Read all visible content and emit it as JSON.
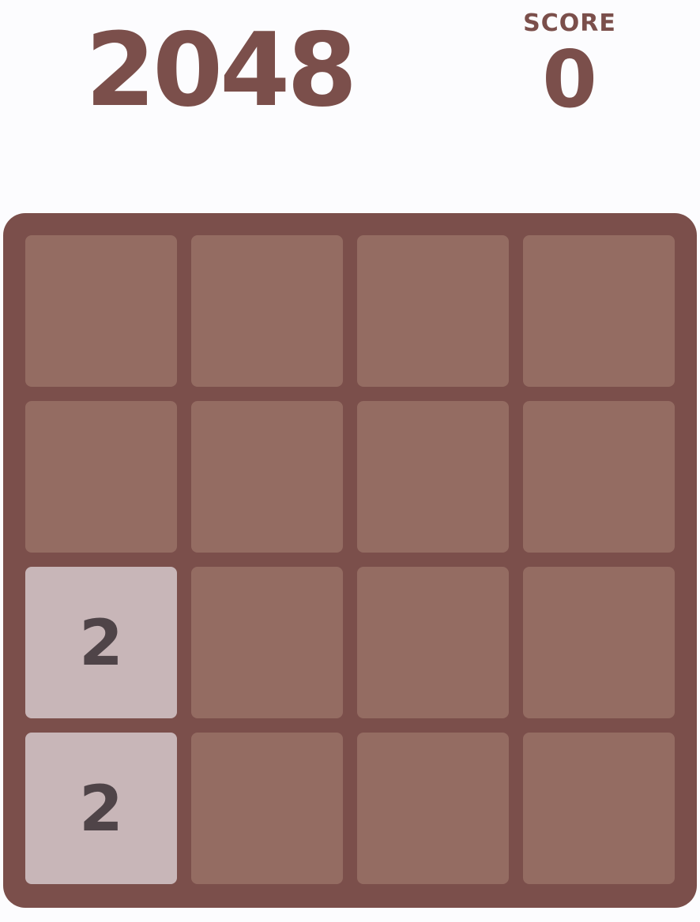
{
  "title": "2048",
  "score": {
    "label": "SCORE",
    "value": "0"
  },
  "colors": {
    "page_background": "#fcfcfe",
    "board_background": "#7b4f4b",
    "empty_cell": "#946c62",
    "tile_2": "#c8b6b8",
    "tile_text": "#4f4448",
    "header_text": "#7b4f4b"
  },
  "board": {
    "rows": [
      [
        "",
        "",
        "",
        ""
      ],
      [
        "",
        "",
        "",
        ""
      ],
      [
        "2",
        "",
        "",
        ""
      ],
      [
        "2",
        "",
        "",
        ""
      ]
    ]
  }
}
